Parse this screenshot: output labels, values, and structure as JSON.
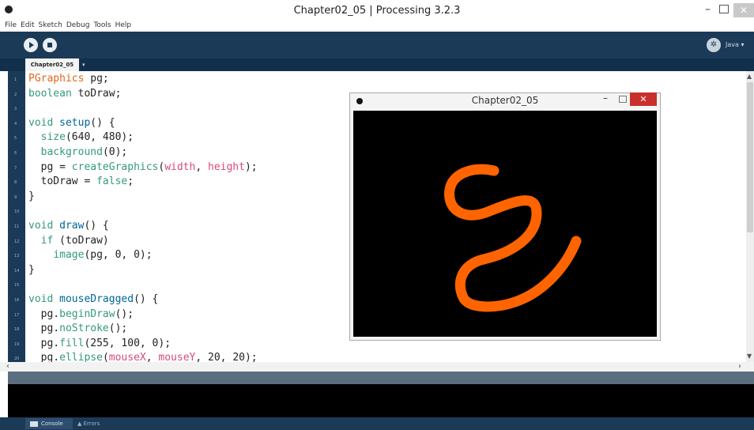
{
  "window": {
    "title": "Chapter02_05 | Processing 3.2.3",
    "minimize": "–",
    "close": "✕"
  },
  "menu": [
    "File",
    "Edit",
    "Sketch",
    "Debug",
    "Tools",
    "Help"
  ],
  "toolbar": {
    "run_icon": "play-icon",
    "stop_icon": "stop-icon",
    "mode": "Java ▾"
  },
  "tabs": {
    "active": "Chapter02_05",
    "arrow": "▾"
  },
  "colors": {
    "toolbar_bg": "#1b3a58",
    "keyword": "#33997e",
    "function_blue": "#006699",
    "builtin_pink": "#d94a7a",
    "type_orange": "#e2661a",
    "stroke_orange": "#ff6400"
  },
  "code": [
    {
      "text": "PGraphics pg;"
    },
    {
      "text": "boolean toDraw;"
    },
    {
      "text": ""
    },
    {
      "text": "void setup() {"
    },
    {
      "text": "  size(640, 480);"
    },
    {
      "text": "  background(0);"
    },
    {
      "text": "  pg = createGraphics(width, height);"
    },
    {
      "text": "  toDraw = false;"
    },
    {
      "text": "}"
    },
    {
      "text": ""
    },
    {
      "text": "void draw() {"
    },
    {
      "text": "  if (toDraw)"
    },
    {
      "text": "    image(pg, 0, 0);"
    },
    {
      "text": "}"
    },
    {
      "text": ""
    },
    {
      "text": "void mouseDragged() {"
    },
    {
      "text": "  pg.beginDraw();"
    },
    {
      "text": "  pg.noStroke();"
    },
    {
      "text": "  pg.fill(255, 100, 0);"
    },
    {
      "text": "  pg.ellipse(mouseX, mouseY, 20, 20);"
    }
  ],
  "sketch": {
    "title": "Chapter02_05",
    "minimize": "–",
    "close": "✕"
  },
  "bottom_tabs": {
    "console": "Console",
    "errors": "Errors"
  }
}
